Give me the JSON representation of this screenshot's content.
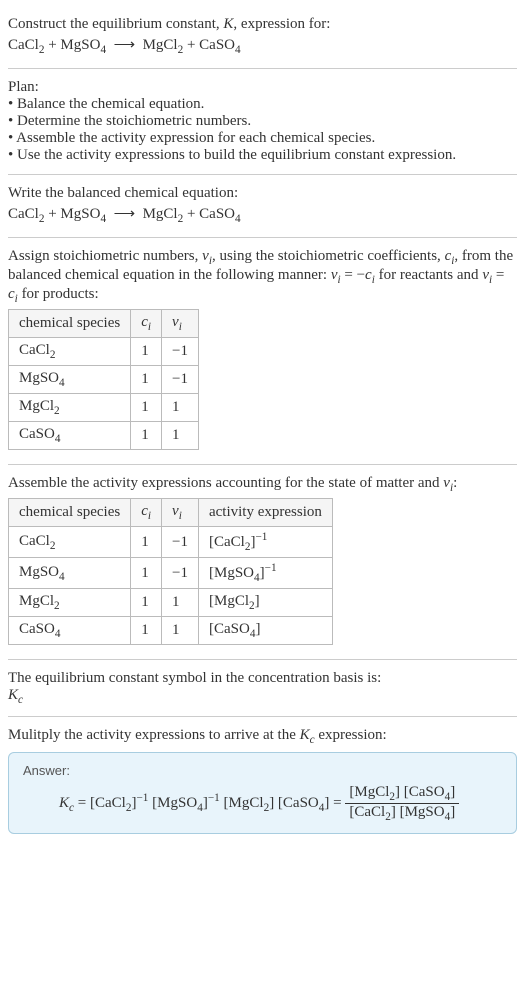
{
  "title_line1": "Construct the equilibrium constant, K, expression for:",
  "equation_unbalanced": "CaCl₂ + MgSO₄ ⟶ MgCl₂ + CaSO₄",
  "plan_heading": "Plan:",
  "plan_items": [
    "• Balance the chemical equation.",
    "• Determine the stoichiometric numbers.",
    "• Assemble the activity expression for each chemical species.",
    "• Use the activity expressions to build the equilibrium constant expression."
  ],
  "balanced_heading": "Write the balanced chemical equation:",
  "equation_balanced": "CaCl₂ + MgSO₄ ⟶ MgCl₂ + CaSO₄",
  "stoich_text": "Assign stoichiometric numbers, νᵢ, using the stoichiometric coefficients, cᵢ, from the balanced chemical equation in the following manner: νᵢ = −cᵢ for reactants and νᵢ = cᵢ for products:",
  "table1": {
    "headers": [
      "chemical species",
      "cᵢ",
      "νᵢ"
    ],
    "rows": [
      [
        "CaCl₂",
        "1",
        "−1"
      ],
      [
        "MgSO₄",
        "1",
        "−1"
      ],
      [
        "MgCl₂",
        "1",
        "1"
      ],
      [
        "CaSO₄",
        "1",
        "1"
      ]
    ]
  },
  "activity_heading": "Assemble the activity expressions accounting for the state of matter and νᵢ:",
  "table2": {
    "headers": [
      "chemical species",
      "cᵢ",
      "νᵢ",
      "activity expression"
    ],
    "rows": [
      [
        "CaCl₂",
        "1",
        "−1",
        "[CaCl₂]⁻¹"
      ],
      [
        "MgSO₄",
        "1",
        "−1",
        "[MgSO₄]⁻¹"
      ],
      [
        "MgCl₂",
        "1",
        "1",
        "[MgCl₂]"
      ],
      [
        "CaSO₄",
        "1",
        "1",
        "[CaSO₄]"
      ]
    ]
  },
  "eq_symbol_text1": "The equilibrium constant symbol in the concentration basis is:",
  "eq_symbol_text2": "K_c",
  "multiply_text": "Mulitply the activity expressions to arrive at the K_c expression:",
  "answer_label": "Answer:",
  "answer_lhs": "K_c = [CaCl₂]⁻¹ [MgSO₄]⁻¹ [MgCl₂] [CaSO₄] = ",
  "answer_frac_num": "[MgCl₂] [CaSO₄]",
  "answer_frac_den": "[CaCl₂] [MgSO₄]",
  "chart_data": {
    "type": "table",
    "tables": [
      {
        "title": "stoichiometric numbers",
        "columns": [
          "chemical species",
          "c_i",
          "nu_i"
        ],
        "rows": [
          {
            "chemical species": "CaCl2",
            "c_i": 1,
            "nu_i": -1
          },
          {
            "chemical species": "MgSO4",
            "c_i": 1,
            "nu_i": -1
          },
          {
            "chemical species": "MgCl2",
            "c_i": 1,
            "nu_i": 1
          },
          {
            "chemical species": "CaSO4",
            "c_i": 1,
            "nu_i": 1
          }
        ]
      },
      {
        "title": "activity expressions",
        "columns": [
          "chemical species",
          "c_i",
          "nu_i",
          "activity expression"
        ],
        "rows": [
          {
            "chemical species": "CaCl2",
            "c_i": 1,
            "nu_i": -1,
            "activity expression": "[CaCl2]^-1"
          },
          {
            "chemical species": "MgSO4",
            "c_i": 1,
            "nu_i": -1,
            "activity expression": "[MgSO4]^-1"
          },
          {
            "chemical species": "MgCl2",
            "c_i": 1,
            "nu_i": 1,
            "activity expression": "[MgCl2]"
          },
          {
            "chemical species": "CaSO4",
            "c_i": 1,
            "nu_i": 1,
            "activity expression": "[CaSO4]"
          }
        ]
      }
    ]
  }
}
